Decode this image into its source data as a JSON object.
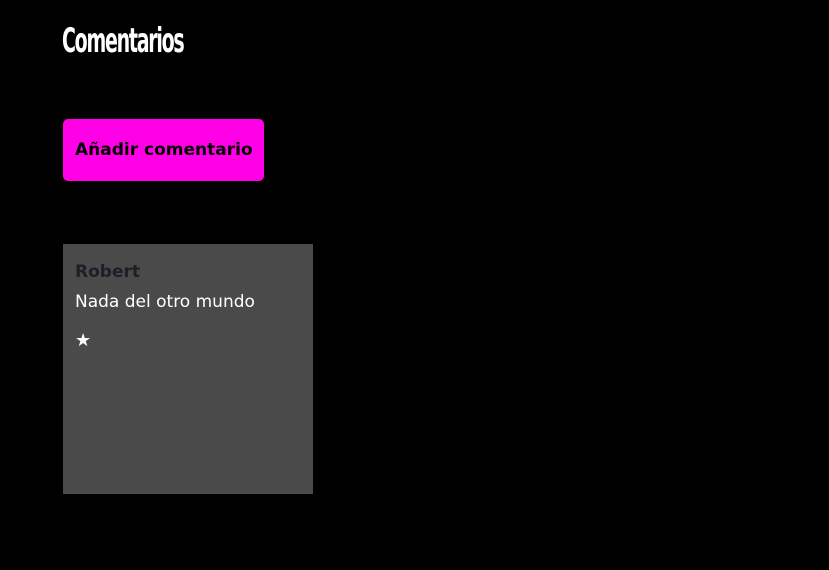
{
  "page": {
    "title": "Comentarios"
  },
  "actions": {
    "add_comment_label": "Añadir comentario"
  },
  "comments": [
    {
      "author": "Robert",
      "text": "Nada del otro mundo",
      "rating": 1,
      "rating_display": "★"
    }
  ],
  "colors": {
    "background": "#000000",
    "accent": "#ff00e6",
    "card": "#4a4a4a",
    "author_text": "#1c1f26",
    "body_text": "#ffffff"
  },
  "icons": {
    "rating": "star-icon"
  }
}
